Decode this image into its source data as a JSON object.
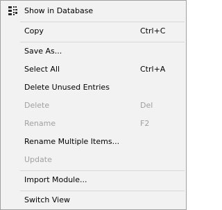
{
  "menu": {
    "items": [
      {
        "label": "Show in Database",
        "shortcut": "",
        "icon": "database-grid-icon",
        "enabled": true
      },
      {
        "label": "Copy",
        "shortcut": "Ctrl+C",
        "enabled": true
      },
      {
        "label": "Save As...",
        "shortcut": "",
        "enabled": true
      },
      {
        "label": "Select All",
        "shortcut": "Ctrl+A",
        "enabled": true
      },
      {
        "label": "Delete Unused Entries",
        "shortcut": "",
        "enabled": true
      },
      {
        "label": "Delete",
        "shortcut": "Del",
        "enabled": false
      },
      {
        "label": "Rename",
        "shortcut": "F2",
        "enabled": false
      },
      {
        "label": "Rename Multiple Items...",
        "shortcut": "",
        "enabled": true
      },
      {
        "label": "Update",
        "shortcut": "",
        "enabled": false
      },
      {
        "label": "Import Module...",
        "shortcut": "",
        "enabled": true
      },
      {
        "label": "Switch View",
        "shortcut": "",
        "enabled": true
      }
    ]
  },
  "colors": {
    "background": "#f2f2f2",
    "border": "#a0a0a0",
    "separator": "#d7d7d7",
    "disabled_text": "#a0a0a0"
  }
}
